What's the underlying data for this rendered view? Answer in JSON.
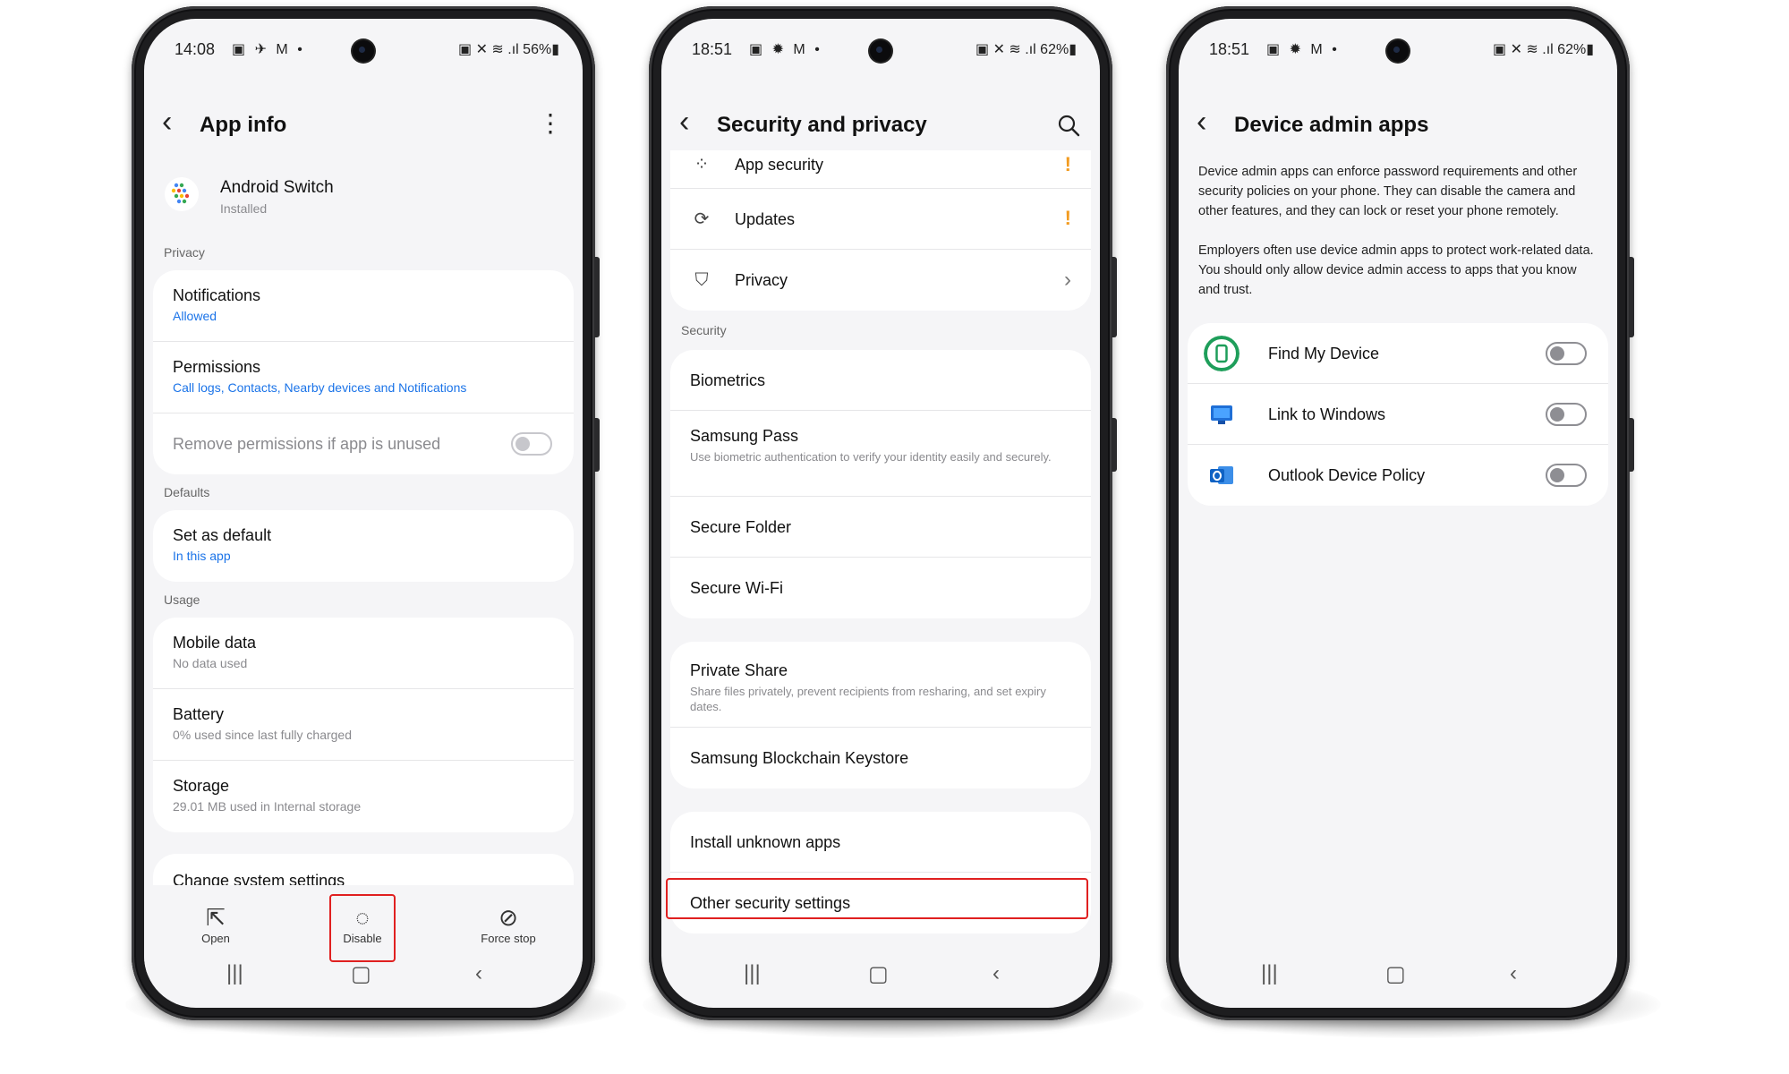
{
  "phone1": {
    "status": {
      "time": "14:08",
      "left_icons": "▣ ✈ M •",
      "right": "▣ ✕ ≋ .ıl 56%▮"
    },
    "title": "App info",
    "app": {
      "name": "Android Switch",
      "status": "Installed"
    },
    "sections": {
      "privacy": "Privacy",
      "defaults": "Defaults",
      "usage": "Usage"
    },
    "notifications": {
      "title": "Notifications",
      "sub": "Allowed"
    },
    "permissions": {
      "title": "Permissions",
      "sub": "Call logs, Contacts, Nearby devices and Notifications"
    },
    "remove_permissions": "Remove permissions if app is unused",
    "set_default": {
      "title": "Set as default",
      "sub": "In this app"
    },
    "mobile_data": {
      "title": "Mobile data",
      "sub": "No data used"
    },
    "battery": {
      "title": "Battery",
      "sub": "0% used since last fully charged"
    },
    "storage": {
      "title": "Storage",
      "sub": "29.01 MB used in Internal storage"
    },
    "change_system": {
      "title": "Change system settings"
    },
    "actions": {
      "open": "Open",
      "disable": "Disable",
      "force_stop": "Force stop"
    }
  },
  "phone2": {
    "status": {
      "time": "18:51",
      "left_icons": "▣ ✹ M •",
      "right": "▣ ✕ ≋ .ıl 62%▮"
    },
    "title": "Security and privacy",
    "app_security": "App security",
    "updates": "Updates",
    "privacy": "Privacy",
    "section_security": "Security",
    "biometrics": "Biometrics",
    "samsung_pass": {
      "title": "Samsung Pass",
      "sub": "Use biometric authentication to verify your identity easily and securely."
    },
    "secure_folder": "Secure Folder",
    "secure_wifi": "Secure Wi-Fi",
    "private_share": {
      "title": "Private Share",
      "sub": "Share files privately, prevent recipients from resharing, and set expiry dates."
    },
    "blockchain": "Samsung Blockchain Keystore",
    "install_unknown": "Install unknown apps",
    "other_security": "Other security settings"
  },
  "phone3": {
    "status": {
      "time": "18:51",
      "left_icons": "▣ ✹ M •",
      "right": "▣ ✕ ≋ .ıl 62%▮"
    },
    "title": "Device admin apps",
    "desc1": "Device admin apps can enforce password requirements and other security policies on your phone. They can disable the camera and other features, and they can lock or reset your phone remotely.",
    "desc2": "Employers often use device admin apps to protect work-related data. You should only allow device admin access to apps that you know and trust.",
    "apps": [
      "Find My Device",
      "Link to Windows",
      "Outlook Device Policy"
    ]
  },
  "colors": {
    "accent_blue": "#1a73e8",
    "highlight_red": "#e02020",
    "warning_orange": "#f29b20"
  }
}
